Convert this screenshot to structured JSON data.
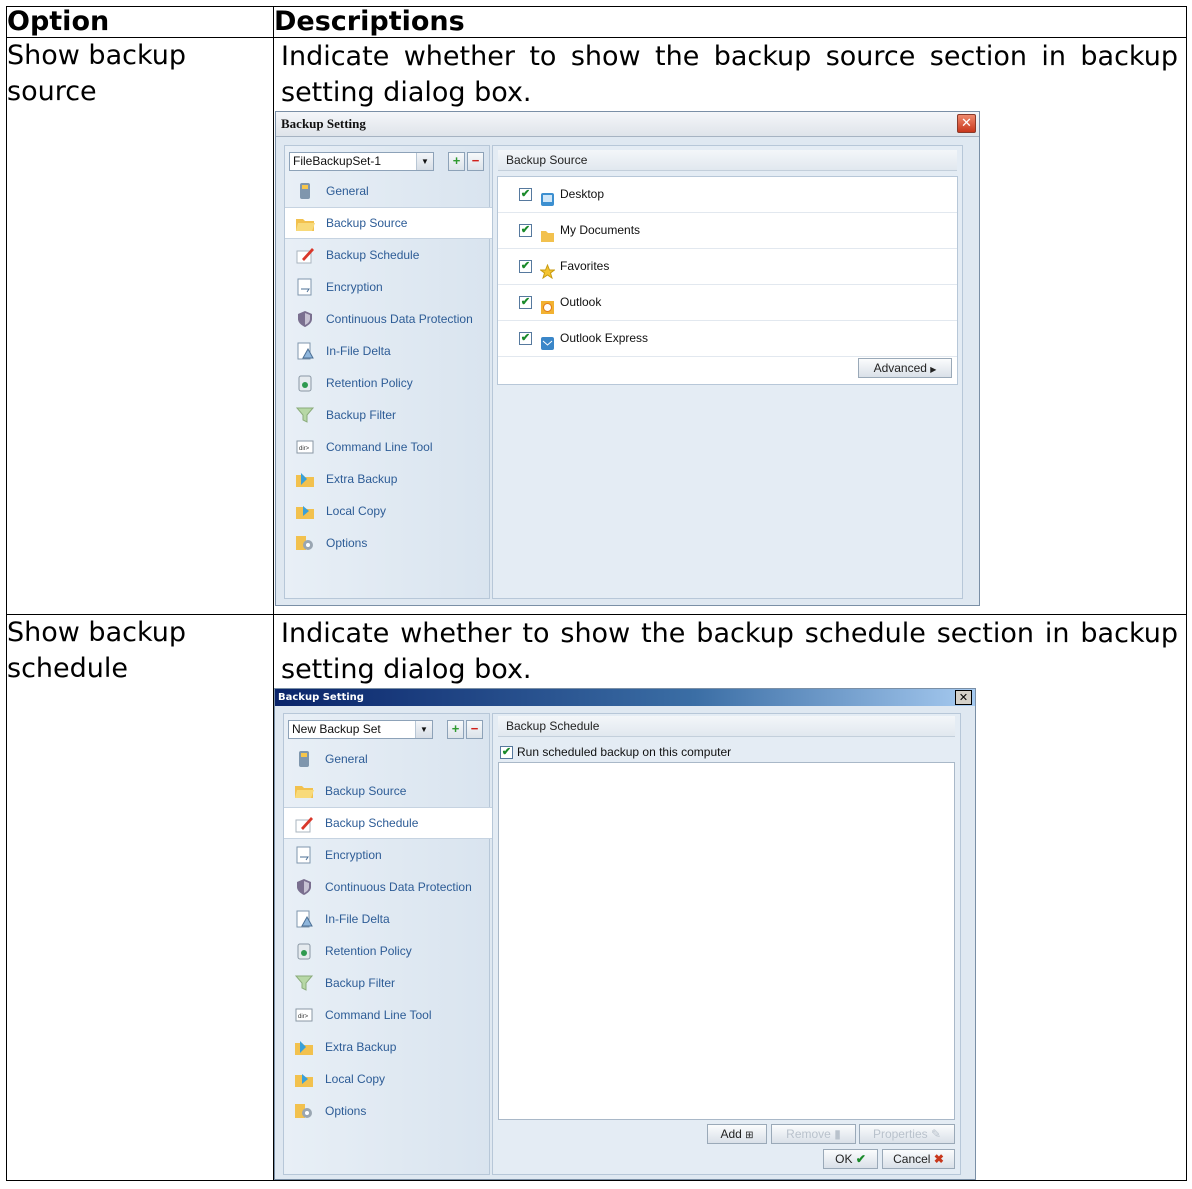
{
  "table": {
    "headers": [
      "Option",
      "Descriptions"
    ],
    "rows": [
      {
        "option": "Show backup source",
        "description": "Indicate whether to show the backup source section in backup setting dialog box.",
        "dialog": {
          "title": "Backup Setting",
          "backup_set": "FileBackupSet-1",
          "section_title": "Backup Source",
          "sources": [
            {
              "label": "Desktop",
              "icon": "desktop-icon",
              "checked": true
            },
            {
              "label": "My Documents",
              "icon": "folder-icon",
              "checked": true
            },
            {
              "label": "Favorites",
              "icon": "star-icon",
              "checked": true
            },
            {
              "label": "Outlook",
              "icon": "outlook-icon",
              "checked": true
            },
            {
              "label": "Outlook Express",
              "icon": "outlook-express-icon",
              "checked": true
            }
          ],
          "advanced_label": "Advanced"
        }
      },
      {
        "option": "Show backup schedule",
        "description": "Indicate whether to show the backup schedule section in backup setting dialog box.",
        "dialog": {
          "title": "Backup Setting",
          "backup_set": "New Backup Set",
          "section_title": "Backup Schedule",
          "run_scheduled_label": "Run scheduled backup on this computer",
          "run_scheduled_checked": true,
          "add_label": "Add",
          "remove_label": "Remove",
          "properties_label": "Properties",
          "ok_label": "OK",
          "cancel_label": "Cancel"
        }
      }
    ]
  },
  "nav_items": [
    {
      "label": "General",
      "icon": "general-icon"
    },
    {
      "label": "Backup Source",
      "icon": "backup-source-folder-icon"
    },
    {
      "label": "Backup Schedule",
      "icon": "schedule-pencil-icon"
    },
    {
      "label": "Encryption",
      "icon": "encryption-icon"
    },
    {
      "label": "Continuous Data Protection",
      "icon": "shield-icon"
    },
    {
      "label": "In-File Delta",
      "icon": "delta-icon"
    },
    {
      "label": "Retention Policy",
      "icon": "recycle-bin-icon"
    },
    {
      "label": "Backup Filter",
      "icon": "filter-funnel-icon"
    },
    {
      "label": "Command Line Tool",
      "icon": "command-line-icon"
    },
    {
      "label": "Extra Backup",
      "icon": "extra-backup-icon"
    },
    {
      "label": "Local Copy",
      "icon": "local-copy-icon"
    },
    {
      "label": "Options",
      "icon": "options-gear-icon"
    }
  ],
  "colors": {
    "nav_text": "#2d5c96",
    "panel_bg": "#dfe8f1",
    "check_green": "#1a8a2a",
    "close_red": "#c8371c"
  }
}
